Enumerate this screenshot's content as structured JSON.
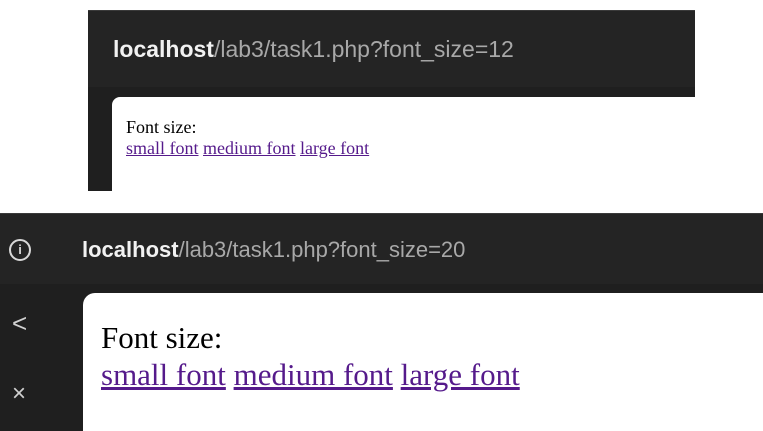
{
  "screenshots": [
    {
      "address_bar": {
        "host": "localhost",
        "path": "/lab3/task1.php?font_size=12"
      },
      "page": {
        "label": "Font size:",
        "links": [
          "small font",
          "medium font",
          "large font"
        ]
      }
    },
    {
      "address_bar": {
        "host": "localhost",
        "path": "/lab3/task1.php?font_size=20",
        "info_icon": "info-icon"
      },
      "side_controls": {
        "back_icon": "chevron-left-icon",
        "back_glyph": "<",
        "close_icon": "close-icon",
        "close_glyph": "×"
      },
      "page": {
        "label": "Font size:",
        "links": [
          "small font",
          "medium font",
          "large font"
        ]
      }
    }
  ],
  "colors": {
    "chrome_bg": "#1f1f1f",
    "address_bar_bg": "#242424",
    "host_text": "#f2f2f2",
    "path_text": "#a8a8a8",
    "visited_link": "#551a8b"
  }
}
